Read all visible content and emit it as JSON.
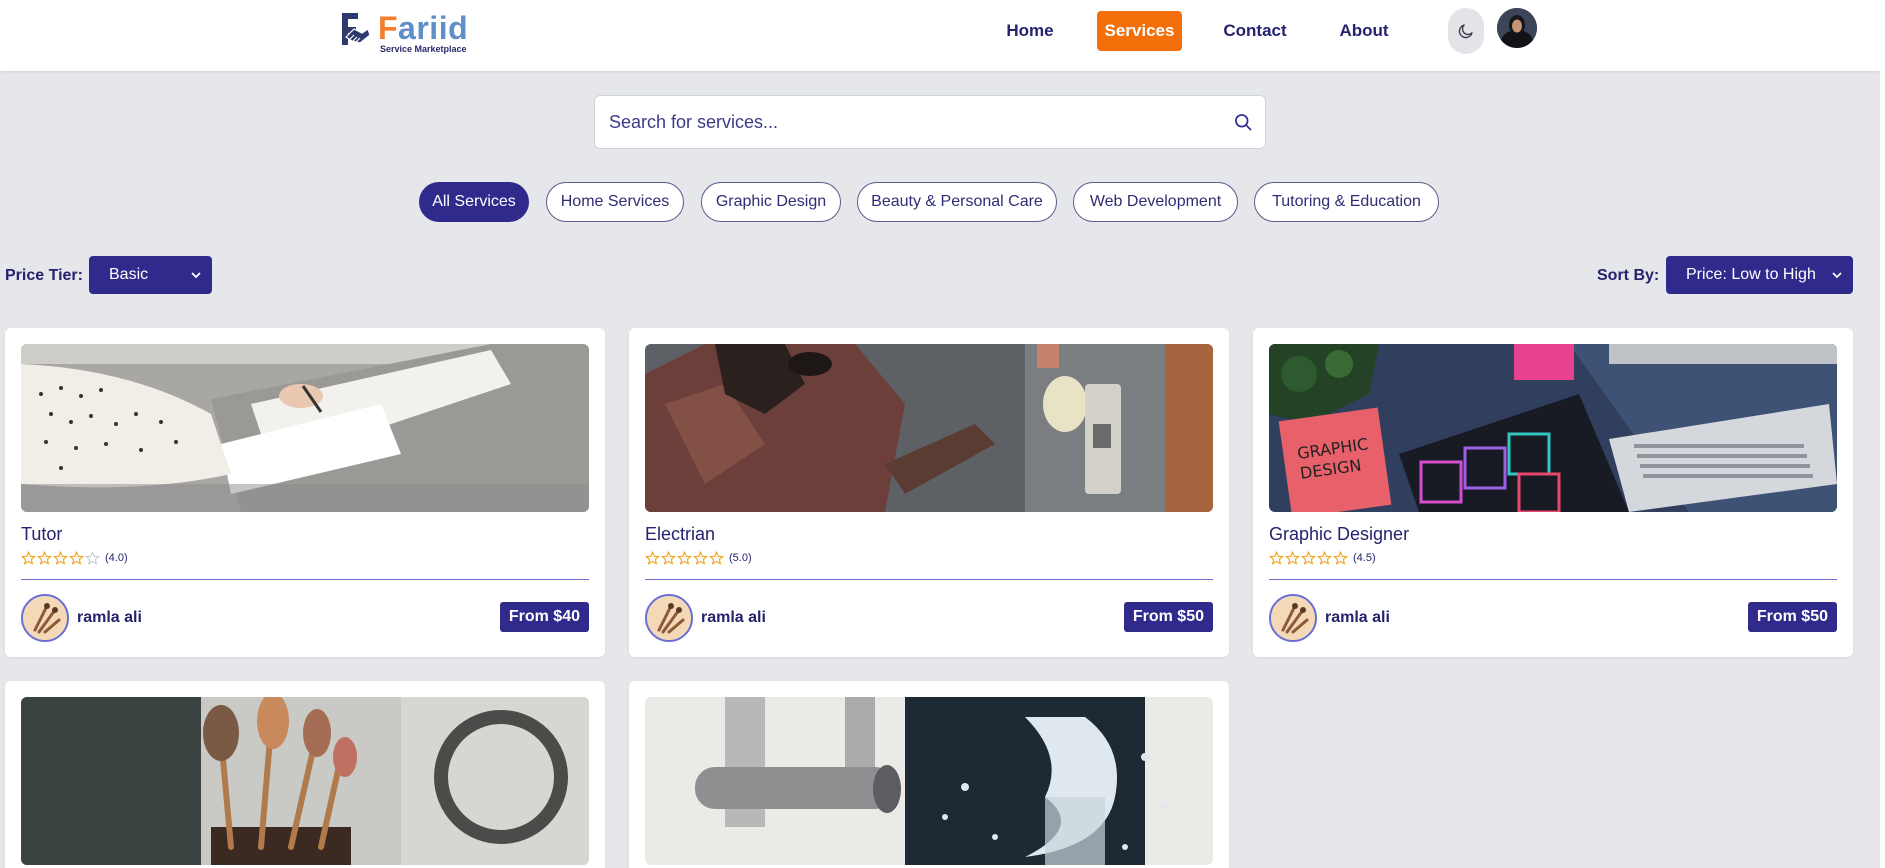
{
  "nav": {
    "logo": {
      "brand_first": "F",
      "brand_rest": "ariid",
      "tagline": "Service Marketplace"
    },
    "links": [
      {
        "label": "Home",
        "active": false
      },
      {
        "label": "Services",
        "active": true
      },
      {
        "label": "Contact",
        "active": false
      },
      {
        "label": "About",
        "active": false
      }
    ],
    "theme_toggle_icon": "moon-icon",
    "accent_color": "#f46f0a"
  },
  "search": {
    "placeholder": "Search for services...",
    "value": "",
    "icon": "search-icon"
  },
  "categories": [
    {
      "label": "All Services",
      "active": true
    },
    {
      "label": "Home Services",
      "active": false
    },
    {
      "label": "Graphic Design",
      "active": false
    },
    {
      "label": "Beauty & Personal Care",
      "active": false
    },
    {
      "label": "Web Development",
      "active": false
    },
    {
      "label": "Tutoring & Education",
      "active": false
    }
  ],
  "filters": {
    "price_tier_label": "Price Tier:",
    "price_tier_value": "Basic",
    "sort_label": "Sort By:",
    "sort_value": "Price: Low to High"
  },
  "services": [
    {
      "title": "Tutor",
      "rating": 4.0,
      "rating_text": "(4.0)",
      "seller": "ramla ali",
      "price": "From $40",
      "image": "tutor-writing-photo"
    },
    {
      "title": "Electrian",
      "rating": 5.0,
      "rating_text": "(5.0)",
      "seller": "ramla ali",
      "price": "From $50",
      "image": "electrician-photo"
    },
    {
      "title": "Graphic Designer",
      "rating": 4.5,
      "rating_text": "(4.5)",
      "seller": "ramla ali",
      "price": "From $50",
      "image": "design-desk-photo"
    },
    {
      "title": "",
      "image": "makeup-brushes-photo"
    },
    {
      "title": "",
      "image": "faucet-water-photo"
    }
  ],
  "colors": {
    "primary": "#302a8c",
    "accent": "#f46f0a",
    "background": "#e5e7eb",
    "star": "#f59e0b"
  }
}
